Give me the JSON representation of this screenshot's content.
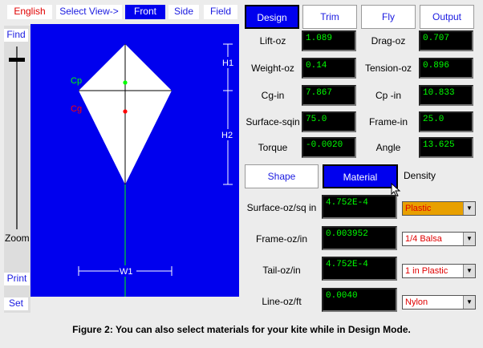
{
  "top_bar": {
    "units": "English",
    "select_view": "Select View->",
    "views": [
      "Front",
      "Side",
      "Field"
    ],
    "selected_view": "Front"
  },
  "left_panel": {
    "find": "Find",
    "zoom": "Zoom",
    "print": "Print",
    "set": "Set"
  },
  "kite_view": {
    "cp_label": "Cp",
    "cg_label": "Cg",
    "h1_label": "H1",
    "h2_label": "H2",
    "w1_label": "W1",
    "colors": {
      "background": "#0000ee",
      "kite": "#ffffff",
      "cp_marker": "#00ff00",
      "cg_marker": "#ff0000",
      "bridle_line": "#00ff00"
    }
  },
  "mode_tabs": [
    "Design",
    "Trim",
    "Fly",
    "Output"
  ],
  "active_mode": "Design",
  "results": [
    {
      "label": "Lift-oz",
      "value": "1.089"
    },
    {
      "label": "Drag-oz",
      "value": "0.707"
    },
    {
      "label": "Weight-oz",
      "value": "0.14"
    },
    {
      "label": "Tension-oz",
      "value": "0.896"
    },
    {
      "label": "Cg-in",
      "value": "7.867"
    },
    {
      "label": "Cp -in",
      "value": "10.833"
    },
    {
      "label": "Surface-sqin",
      "value": "75.0"
    },
    {
      "label": "Frame-in",
      "value": "25.0"
    },
    {
      "label": "Torque",
      "value": "-0.0020"
    },
    {
      "label": "Angle",
      "value": "13.625"
    }
  ],
  "sub_tabs": {
    "shape": "Shape",
    "material": "Material",
    "density": "Density"
  },
  "materials": [
    {
      "label": "Surface-oz/sq in",
      "value": "4.752E-4",
      "option": "Plastic"
    },
    {
      "label": "Frame-oz/in",
      "value": "0.003952",
      "option": "1/4 Balsa"
    },
    {
      "label": "Tail-oz/in",
      "value": "4.752E-4",
      "option": "1 in Plastic"
    },
    {
      "label": "Line-oz/ft",
      "value": "0.0040",
      "option": "Nylon"
    }
  ],
  "caption": "Figure 2: You can also select materials for your kite while in Design Mode."
}
